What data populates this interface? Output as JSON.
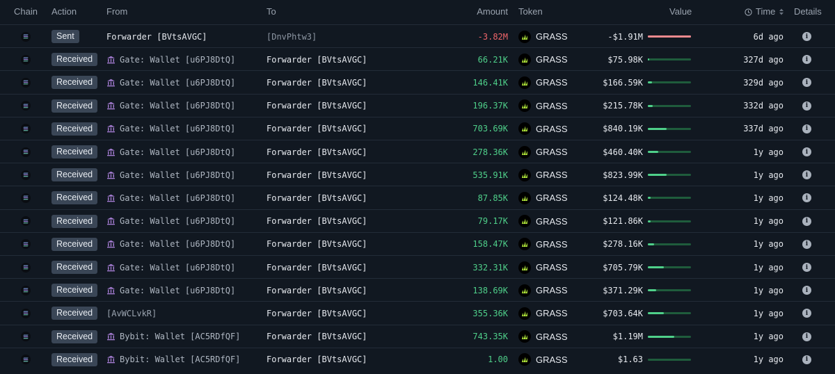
{
  "header": {
    "chain": "Chain",
    "action": "Action",
    "from": "From",
    "to": "To",
    "amount": "Amount",
    "token": "Token",
    "value": "Value",
    "time": "Time",
    "details": "Details"
  },
  "colors": {
    "background": "#111821",
    "positive": "#4fd08a",
    "negative": "#f0656a",
    "badge": "#3a4656",
    "from_entity_icon": "#a87fd6",
    "token_accent": "#b8f03c"
  },
  "icons": {
    "chain": "solana-icon",
    "token": "grass-token-icon",
    "from_entity": "bank-icon",
    "details": "info-icon",
    "time_header": "clock-icon",
    "sort": "sort-icon"
  },
  "rows": [
    {
      "action": "Sent",
      "from": "Forwarder [BVtsAVGC]",
      "from_kind": "main",
      "to": "[DnvPhtw3]",
      "to_kind": "addr",
      "amount": "-3.82M",
      "sign": "neg",
      "token": "GRASS",
      "value": "-$1.91M",
      "bar": 1.0,
      "time": "6d ago"
    },
    {
      "action": "Received",
      "from": "Gate: Wallet [u6PJ8DtQ]",
      "from_kind": "entity",
      "to": "Forwarder [BVtsAVGC]",
      "to_kind": "main",
      "amount": "66.21K",
      "sign": "pos",
      "token": "GRASS",
      "value": "$75.98K",
      "bar": 0.04,
      "time": "327d ago"
    },
    {
      "action": "Received",
      "from": "Gate: Wallet [u6PJ8DtQ]",
      "from_kind": "entity",
      "to": "Forwarder [BVtsAVGC]",
      "to_kind": "main",
      "amount": "146.41K",
      "sign": "pos",
      "token": "GRASS",
      "value": "$166.59K",
      "bar": 0.09,
      "time": "329d ago"
    },
    {
      "action": "Received",
      "from": "Gate: Wallet [u6PJ8DtQ]",
      "from_kind": "entity",
      "to": "Forwarder [BVtsAVGC]",
      "to_kind": "main",
      "amount": "196.37K",
      "sign": "pos",
      "token": "GRASS",
      "value": "$215.78K",
      "bar": 0.11,
      "time": "332d ago"
    },
    {
      "action": "Received",
      "from": "Gate: Wallet [u6PJ8DtQ]",
      "from_kind": "entity",
      "to": "Forwarder [BVtsAVGC]",
      "to_kind": "main",
      "amount": "703.69K",
      "sign": "pos",
      "token": "GRASS",
      "value": "$840.19K",
      "bar": 0.44,
      "time": "337d ago"
    },
    {
      "action": "Received",
      "from": "Gate: Wallet [u6PJ8DtQ]",
      "from_kind": "entity",
      "to": "Forwarder [BVtsAVGC]",
      "to_kind": "main",
      "amount": "278.36K",
      "sign": "pos",
      "token": "GRASS",
      "value": "$460.40K",
      "bar": 0.24,
      "time": "1y ago"
    },
    {
      "action": "Received",
      "from": "Gate: Wallet [u6PJ8DtQ]",
      "from_kind": "entity",
      "to": "Forwarder [BVtsAVGC]",
      "to_kind": "main",
      "amount": "535.91K",
      "sign": "pos",
      "token": "GRASS",
      "value": "$823.99K",
      "bar": 0.43,
      "time": "1y ago"
    },
    {
      "action": "Received",
      "from": "Gate: Wallet [u6PJ8DtQ]",
      "from_kind": "entity",
      "to": "Forwarder [BVtsAVGC]",
      "to_kind": "main",
      "amount": "87.85K",
      "sign": "pos",
      "token": "GRASS",
      "value": "$124.48K",
      "bar": 0.07,
      "time": "1y ago"
    },
    {
      "action": "Received",
      "from": "Gate: Wallet [u6PJ8DtQ]",
      "from_kind": "entity",
      "to": "Forwarder [BVtsAVGC]",
      "to_kind": "main",
      "amount": "79.17K",
      "sign": "pos",
      "token": "GRASS",
      "value": "$121.86K",
      "bar": 0.06,
      "time": "1y ago"
    },
    {
      "action": "Received",
      "from": "Gate: Wallet [u6PJ8DtQ]",
      "from_kind": "entity",
      "to": "Forwarder [BVtsAVGC]",
      "to_kind": "main",
      "amount": "158.47K",
      "sign": "pos",
      "token": "GRASS",
      "value": "$278.16K",
      "bar": 0.15,
      "time": "1y ago"
    },
    {
      "action": "Received",
      "from": "Gate: Wallet [u6PJ8DtQ]",
      "from_kind": "entity",
      "to": "Forwarder [BVtsAVGC]",
      "to_kind": "main",
      "amount": "332.31K",
      "sign": "pos",
      "token": "GRASS",
      "value": "$705.79K",
      "bar": 0.37,
      "time": "1y ago"
    },
    {
      "action": "Received",
      "from": "Gate: Wallet [u6PJ8DtQ]",
      "from_kind": "entity",
      "to": "Forwarder [BVtsAVGC]",
      "to_kind": "main",
      "amount": "138.69K",
      "sign": "pos",
      "token": "GRASS",
      "value": "$371.29K",
      "bar": 0.19,
      "time": "1y ago"
    },
    {
      "action": "Received",
      "from": "[AvWCLvkR]",
      "from_kind": "addr",
      "to": "Forwarder [BVtsAVGC]",
      "to_kind": "main",
      "amount": "355.36K",
      "sign": "pos",
      "token": "GRASS",
      "value": "$703.64K",
      "bar": 0.37,
      "time": "1y ago"
    },
    {
      "action": "Received",
      "from": "Bybit: Wallet [AC5RDfQF]",
      "from_kind": "entity",
      "to": "Forwarder [BVtsAVGC]",
      "to_kind": "main",
      "amount": "743.35K",
      "sign": "pos",
      "token": "GRASS",
      "value": "$1.19M",
      "bar": 0.62,
      "time": "1y ago"
    },
    {
      "action": "Received",
      "from": "Bybit: Wallet [AC5RDfQF]",
      "from_kind": "entity",
      "to": "Forwarder [BVtsAVGC]",
      "to_kind": "main",
      "amount": "1.00",
      "sign": "pos",
      "token": "GRASS",
      "value": "$1.63",
      "bar": 0.0,
      "time": "1y ago"
    }
  ]
}
